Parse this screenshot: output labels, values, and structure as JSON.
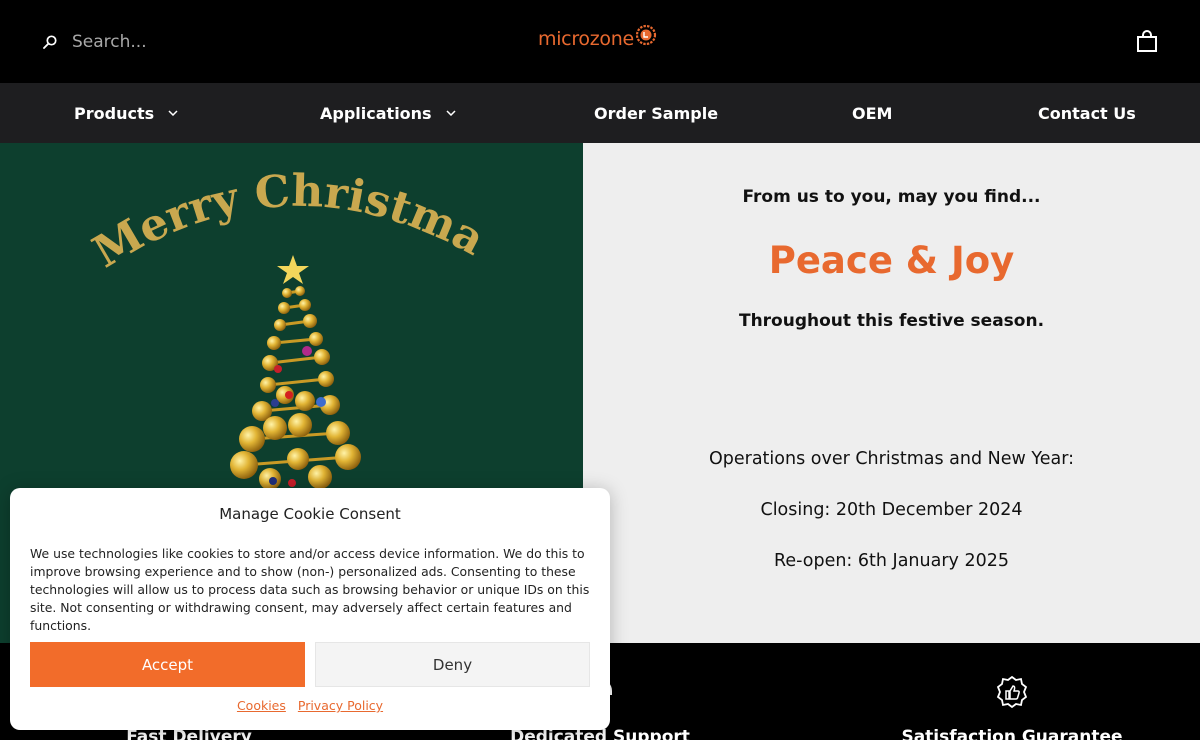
{
  "header": {
    "search_placeholder": "Search...",
    "logo_text": "microzone",
    "brand_color": "#e8692f"
  },
  "nav": {
    "items": [
      {
        "label": "Products",
        "has_dropdown": true
      },
      {
        "label": "Applications",
        "has_dropdown": true
      },
      {
        "label": "Order Sample",
        "has_dropdown": false
      },
      {
        "label": "OEM",
        "has_dropdown": false
      },
      {
        "label": "Contact Us",
        "has_dropdown": false
      }
    ]
  },
  "hero": {
    "banner_text": "Merry Christmas",
    "intro": "From us to you, may you find...",
    "headline": "Peace & Joy",
    "season": "Throughout this festive season.",
    "operations": "Operations over Christmas and New Year:",
    "closing": "Closing: 20th December 2024",
    "reopen": "Re-open: 6th January 2025",
    "left_bg": "#0d3f2e",
    "right_bg": "#eeeeee"
  },
  "features": [
    {
      "title": "Fast Delivery",
      "icon": "truck-icon"
    },
    {
      "title": "Dedicated Support",
      "icon": "headset-icon"
    },
    {
      "title": "Satisfaction Guarantee",
      "icon": "thumbs-up-badge-icon"
    }
  ],
  "cookie": {
    "title": "Manage Cookie Consent",
    "body": "We use technologies like cookies to store and/or access device information. We do this to improve browsing experience and to show (non-) personalized ads. Consenting to these technologies will allow us to process data such as browsing behavior or unique IDs on this site. Not consenting or withdrawing consent, may adversely affect certain features and functions.",
    "accept_label": "Accept",
    "deny_label": "Deny",
    "cookies_link": "Cookies",
    "privacy_link": "Privacy Policy",
    "accept_color": "#f26c2a"
  }
}
